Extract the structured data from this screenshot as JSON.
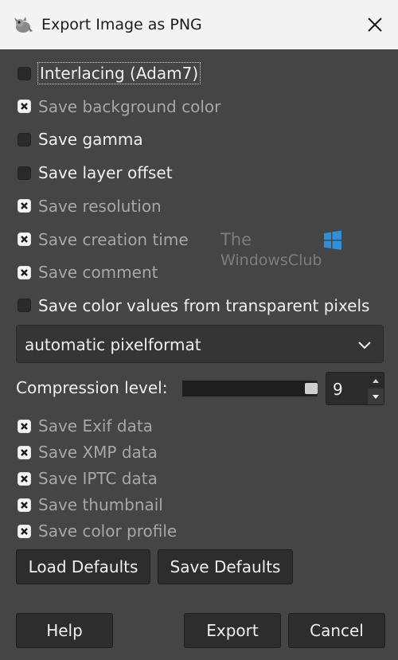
{
  "window": {
    "title": "Export Image as PNG"
  },
  "icons": {
    "app": "gimp-icon",
    "close": "close-icon",
    "dropdown": "chevron-down-icon"
  },
  "options_top": [
    {
      "label": "Interlacing (Adam7)",
      "checked": false,
      "enabled": true
    },
    {
      "label": "Save background color",
      "checked": true,
      "enabled": false
    },
    {
      "label": "Save gamma",
      "checked": false,
      "enabled": true
    },
    {
      "label": "Save layer offset",
      "checked": false,
      "enabled": true
    },
    {
      "label": "Save resolution",
      "checked": true,
      "enabled": false
    },
    {
      "label": "Save creation time",
      "checked": true,
      "enabled": false
    },
    {
      "label": "Save comment",
      "checked": true,
      "enabled": false
    },
    {
      "label": "Save color values from transparent pixels",
      "checked": false,
      "enabled": true
    }
  ],
  "pixelformat": {
    "selected": "automatic pixelformat"
  },
  "compression": {
    "label": "Compression level:",
    "value": "9",
    "max": 9
  },
  "options_bottom": [
    {
      "label": "Save Exif data",
      "checked": true,
      "enabled": false
    },
    {
      "label": "Save XMP data",
      "checked": true,
      "enabled": false
    },
    {
      "label": "Save IPTC data",
      "checked": true,
      "enabled": false
    },
    {
      "label": "Save thumbnail",
      "checked": true,
      "enabled": false
    },
    {
      "label": "Save color profile",
      "checked": true,
      "enabled": false
    }
  ],
  "buttons": {
    "load_defaults": "Load Defaults",
    "save_defaults": "Save Defaults",
    "help": "Help",
    "export": "Export",
    "cancel": "Cancel"
  },
  "watermark": {
    "line1": "The",
    "line2": "WindowsClub"
  },
  "colors": {
    "background": "#454545",
    "titlebar": "#f3f3f3",
    "text_enabled": "#f0f0f0",
    "text_disabled": "#a7a7a7",
    "logo_blue": "#2f8fd8"
  }
}
